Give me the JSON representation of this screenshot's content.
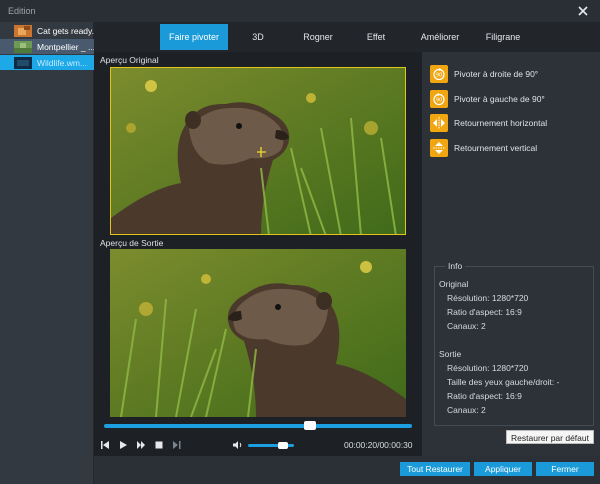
{
  "window": {
    "title": "Edition"
  },
  "files": [
    {
      "name": "Cat gets ready..."
    },
    {
      "name": "Montpellier _ ..."
    },
    {
      "name": "Wildlife.wm..."
    }
  ],
  "tabs": [
    {
      "label": "Faire pivoter",
      "active": true
    },
    {
      "label": "3D"
    },
    {
      "label": "Rogner"
    },
    {
      "label": "Effet"
    },
    {
      "label": "Améliorer"
    },
    {
      "label": "Filigrane"
    }
  ],
  "preview": {
    "original_label": "Aperçu Original",
    "output_label": "Aperçu de Sortie"
  },
  "player": {
    "progress": 0.67,
    "volume": 0.75,
    "timecode": "00:00:20/00:00:30"
  },
  "actions": [
    {
      "label": "Pivoter à droite de 90°",
      "icon": "rotate-right-90-icon"
    },
    {
      "label": "Pivoter à gauche de 90°",
      "icon": "rotate-left-90-icon"
    },
    {
      "label": "Retournement horizontal",
      "icon": "flip-horizontal-icon"
    },
    {
      "label": "Retournement vertical",
      "icon": "flip-vertical-icon"
    }
  ],
  "info": {
    "title": "Info",
    "original_heading": "Original",
    "original": {
      "resolution": "Résolution: 1280*720",
      "aspect": "Ratio d'aspect: 16:9",
      "channels": "Canaux: 2"
    },
    "output_heading": "Sortie",
    "output": {
      "resolution": "Résolution: 1280*720",
      "eye_size": "Taille des yeux gauche/droit: -",
      "aspect": "Ratio d'aspect: 16:9",
      "channels": "Canaux: 2"
    }
  },
  "buttons": {
    "restore_default": "Restaurer par défaut",
    "restore_all": "Tout Restaurer",
    "apply": "Appliquer",
    "close": "Fermer"
  },
  "colors": {
    "accent": "#1a9ad8",
    "icon_orange": "#f0a511",
    "frame_highlight": "#e2c51a"
  }
}
